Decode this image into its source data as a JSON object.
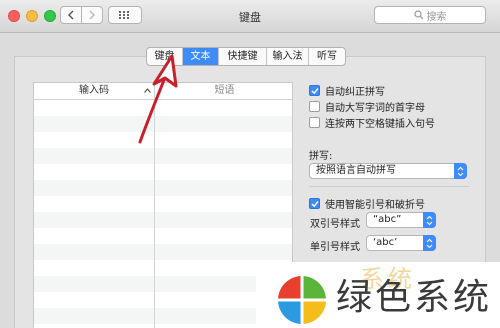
{
  "window": {
    "title": "键盘",
    "search_placeholder": "搜索"
  },
  "tabs": [
    {
      "label": "键盘",
      "active": false
    },
    {
      "label": "文本",
      "active": true
    },
    {
      "label": "快捷键",
      "active": false
    },
    {
      "label": "输入法",
      "active": false
    },
    {
      "label": "听写",
      "active": false
    }
  ],
  "table": {
    "col_input": "输入码",
    "col_phrase": "短语"
  },
  "options": {
    "auto_correct": {
      "label": "自动纠正拼写",
      "checked": true
    },
    "auto_capitalize": {
      "label": "自动大写字词的首字母",
      "checked": false
    },
    "double_space_period": {
      "label": "连按两下空格键插入句号",
      "checked": false
    }
  },
  "spelling": {
    "label": "拼写:",
    "value": "按照语言自动拼写"
  },
  "smart_quotes": {
    "label": "使用智能引号和破折号",
    "checked": true
  },
  "double_quotes": {
    "label": "双引号样式",
    "value": "“abc”"
  },
  "single_quotes": {
    "label": "单引号样式",
    "value": "‘abc’"
  },
  "watermark": {
    "text": "绿色系统",
    "ghost": "系统"
  },
  "colors": {
    "accent": "#3e8bfb",
    "arrow": "#c8202a"
  }
}
